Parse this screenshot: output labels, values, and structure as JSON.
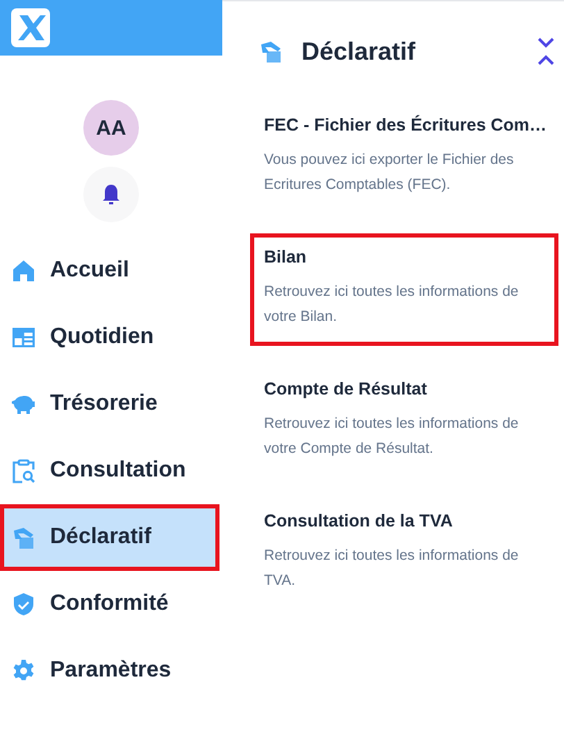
{
  "sidebar": {
    "avatar": "AA",
    "items": [
      {
        "label": "Accueil",
        "selected": false,
        "highlighted": false
      },
      {
        "label": "Quotidien",
        "selected": false,
        "highlighted": false
      },
      {
        "label": "Trésorerie",
        "selected": false,
        "highlighted": false
      },
      {
        "label": "Consultation",
        "selected": false,
        "highlighted": false
      },
      {
        "label": "Déclaratif",
        "selected": true,
        "highlighted": true
      },
      {
        "label": "Conformité",
        "selected": false,
        "highlighted": false
      },
      {
        "label": "Paramètres",
        "selected": false,
        "highlighted": false
      }
    ]
  },
  "panel": {
    "title": "Déclaratif",
    "items": [
      {
        "title": "FEC - Fichier des Écritures Com…",
        "description": "Vous pouvez ici exporter le Fichier des Ecritures Comptables (FEC).",
        "highlighted": false
      },
      {
        "title": "Bilan",
        "description": "Retrouvez ici toutes les informations de votre Bilan.",
        "highlighted": true
      },
      {
        "title": "Compte de Résultat",
        "description": "Retrouvez ici toutes les informations de votre Compte de Résultat.",
        "highlighted": false
      },
      {
        "title": "Consultation de la TVA",
        "description": "Retrouvez ici toutes les informations de TVA.",
        "highlighted": false
      }
    ]
  }
}
